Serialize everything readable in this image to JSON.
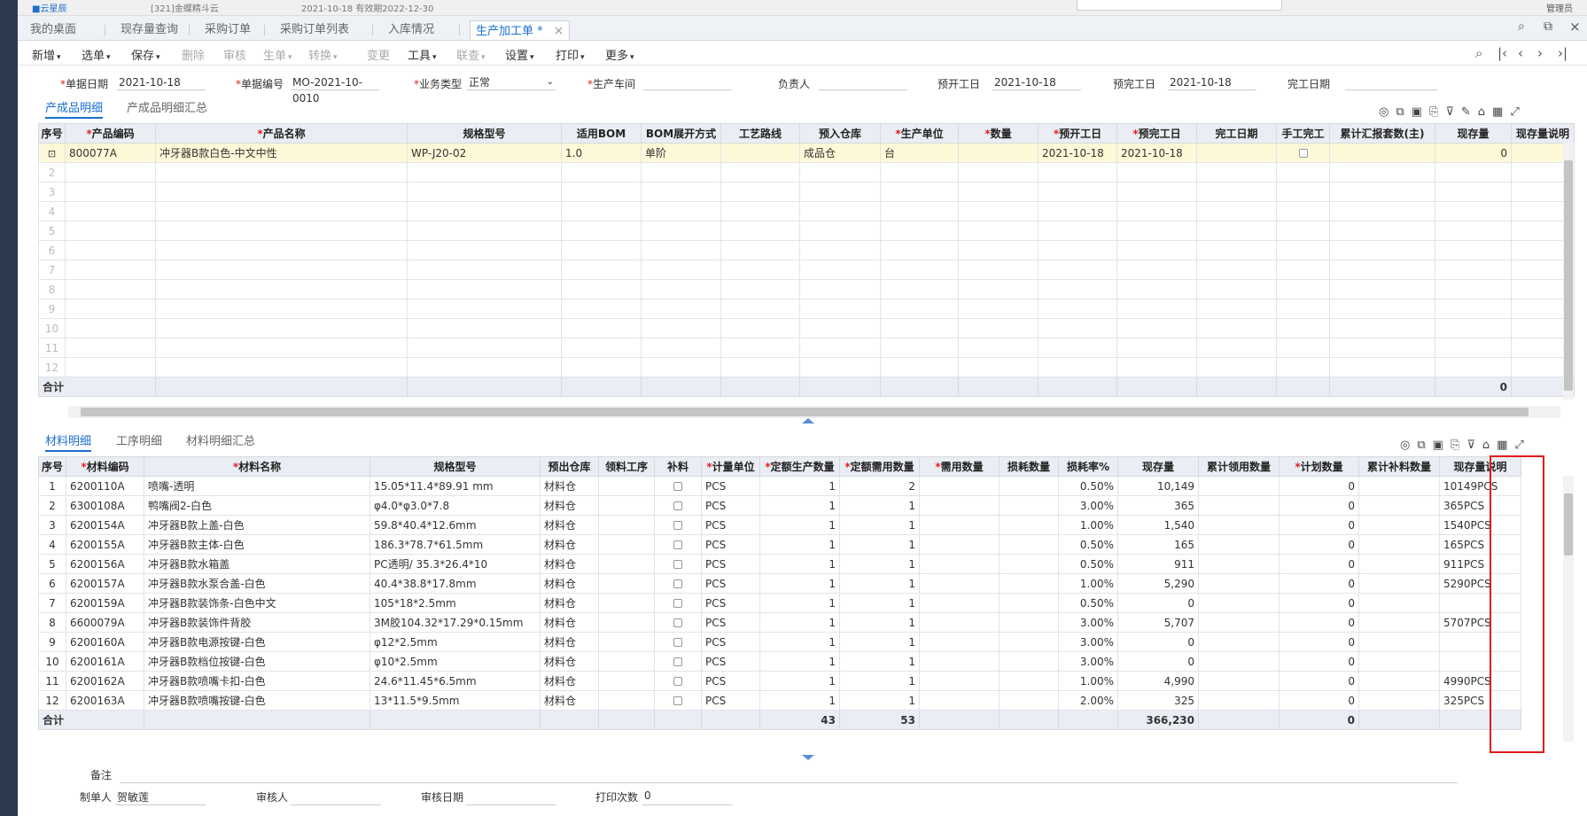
{
  "top": {
    "text1": "■云星辰",
    "text2": "[321]金蝶精斗云",
    "text3": "2021-10-18 有效期2022-12-30",
    "user": "管理员"
  },
  "tabs": [
    {
      "label": "我的桌面"
    },
    {
      "label": "现存量查询"
    },
    {
      "label": "采购订单"
    },
    {
      "label": "采购订单列表"
    },
    {
      "label": "入库情况"
    },
    {
      "label": "生产加工单 *"
    }
  ],
  "close_glyph": "×",
  "toolbar": [
    {
      "label": "新增",
      "dd": true,
      "disabled": false
    },
    {
      "label": "选单",
      "dd": true,
      "disabled": false
    },
    {
      "label": "保存",
      "dd": true,
      "disabled": false
    },
    {
      "label": "删除",
      "dd": false,
      "disabled": true
    },
    {
      "label": "审核",
      "dd": false,
      "disabled": true
    },
    {
      "label": "生单",
      "dd": true,
      "disabled": true
    },
    {
      "label": "转换",
      "dd": true,
      "disabled": true
    },
    {
      "label": "变更",
      "dd": false,
      "disabled": true
    },
    {
      "label": "工具",
      "dd": true,
      "disabled": false
    },
    {
      "label": "联查",
      "dd": true,
      "disabled": true
    },
    {
      "label": "设置",
      "dd": true,
      "disabled": false
    },
    {
      "label": "打印",
      "dd": true,
      "disabled": false
    },
    {
      "label": "更多",
      "dd": true,
      "disabled": false
    }
  ],
  "nav_icons": [
    "search-nav-icon",
    "first-page-icon",
    "prev-page-icon",
    "next-page-icon",
    "last-page-icon"
  ],
  "header_fields": [
    {
      "label": "单据日期",
      "value": "2021-10-18",
      "required": true
    },
    {
      "label": "单据编号",
      "value": "MO-2021-10-0010",
      "required": true
    },
    {
      "label": "业务类型",
      "value": "正常",
      "required": true
    },
    {
      "label": "生产车间",
      "value": "",
      "required": true
    },
    {
      "label": "负责人",
      "value": "",
      "required": false
    },
    {
      "label": "预开工日",
      "value": "2021-10-18",
      "required": false
    },
    {
      "label": "预完工日",
      "value": "2021-10-18",
      "required": false
    },
    {
      "label": "完工日期",
      "value": "",
      "required": false
    }
  ],
  "product_tabs": [
    "产成品明细",
    "产成品明细汇总"
  ],
  "product_grid": {
    "columns": [
      {
        "label": "序号",
        "required": false
      },
      {
        "label": "产品编码",
        "required": true
      },
      {
        "label": "产品名称",
        "required": true
      },
      {
        "label": "规格型号",
        "required": false
      },
      {
        "label": "适用BOM",
        "required": false
      },
      {
        "label": "BOM展开方式",
        "required": false
      },
      {
        "label": "工艺路线",
        "required": false
      },
      {
        "label": "预入仓库",
        "required": false
      },
      {
        "label": "生产单位",
        "required": true
      },
      {
        "label": "数量",
        "required": true
      },
      {
        "label": "预开工日",
        "required": true
      },
      {
        "label": "预完工日",
        "required": true
      },
      {
        "label": "完工日期",
        "required": false
      },
      {
        "label": "手工完工",
        "required": false
      },
      {
        "label": "累计汇报套数(主)",
        "required": false
      },
      {
        "label": "现存量",
        "required": false
      },
      {
        "label": "现存量说明",
        "required": false
      }
    ],
    "rows": [
      {
        "code": "800077A",
        "name": "冲牙器B款白色-中文中性",
        "spec": "WP-J20-02",
        "bom": "1.0",
        "bom_mode": "单阶",
        "route": "",
        "wh": "成品仓",
        "unit": "台",
        "qty": "",
        "start": "2021-10-18",
        "end": "2021-10-18",
        "done": "",
        "manual": "",
        "reported": "",
        "stock": "0",
        "stock_desc": ""
      }
    ],
    "empty_row_numbers": [
      "2",
      "3",
      "4",
      "5",
      "6",
      "7",
      "8",
      "9",
      "10",
      "11",
      "12"
    ],
    "sum_label": "合计",
    "sum_stock": "0"
  },
  "material_tabs": [
    "材料明细",
    "工序明细",
    "材料明细汇总"
  ],
  "material_grid": {
    "columns": [
      {
        "label": "序号",
        "required": false
      },
      {
        "label": "材料编码",
        "required": true
      },
      {
        "label": "材料名称",
        "required": true
      },
      {
        "label": "规格型号",
        "required": false
      },
      {
        "label": "预出仓库",
        "required": false
      },
      {
        "label": "领料工序",
        "required": false
      },
      {
        "label": "补料",
        "required": false
      },
      {
        "label": "计量单位",
        "required": true
      },
      {
        "label": "定额生产数量",
        "required": true
      },
      {
        "label": "定额需用数量",
        "required": true
      },
      {
        "label": "需用数量",
        "required": true
      },
      {
        "label": "损耗数量",
        "required": false
      },
      {
        "label": "损耗率%",
        "required": false
      },
      {
        "label": "现存量",
        "required": false
      },
      {
        "label": "累计领用数量",
        "required": false
      },
      {
        "label": "计划数量",
        "required": true
      },
      {
        "label": "累计补料数量",
        "required": false
      },
      {
        "label": "现存量说明",
        "required": false
      }
    ],
    "rows": [
      {
        "no": "1",
        "code": "6200110A",
        "name": "喷嘴-透明",
        "spec": "15.05*11.4*89.91 mm",
        "wh": "材料仓",
        "unit": "PCS",
        "prod_qty": "1",
        "need_qty": "2",
        "loss_rate": "0.50%",
        "stock": "10,149",
        "plan": "0",
        "stock_desc": "10149PCS"
      },
      {
        "no": "2",
        "code": "6300108A",
        "name": "鸭嘴阀2-白色",
        "spec": "φ4.0*φ3.0*7.8",
        "wh": "材料仓",
        "unit": "PCS",
        "prod_qty": "1",
        "need_qty": "1",
        "loss_rate": "3.00%",
        "stock": "365",
        "plan": "0",
        "stock_desc": "365PCS"
      },
      {
        "no": "3",
        "code": "6200154A",
        "name": "冲牙器B款上盖-白色",
        "spec": "59.8*40.4*12.6mm",
        "wh": "材料仓",
        "unit": "PCS",
        "prod_qty": "1",
        "need_qty": "1",
        "loss_rate": "1.00%",
        "stock": "1,540",
        "plan": "0",
        "stock_desc": "1540PCS"
      },
      {
        "no": "4",
        "code": "6200155A",
        "name": "冲牙器B款主体-白色",
        "spec": "186.3*78.7*61.5mm",
        "wh": "材料仓",
        "unit": "PCS",
        "prod_qty": "1",
        "need_qty": "1",
        "loss_rate": "0.50%",
        "stock": "165",
        "plan": "0",
        "stock_desc": "165PCS"
      },
      {
        "no": "5",
        "code": "6200156A",
        "name": "冲牙器B款水箱盖",
        "spec": "PC透明/ 35.3*26.4*10",
        "wh": "材料仓",
        "unit": "PCS",
        "prod_qty": "1",
        "need_qty": "1",
        "loss_rate": "0.50%",
        "stock": "911",
        "plan": "0",
        "stock_desc": "911PCS"
      },
      {
        "no": "6",
        "code": "6200157A",
        "name": "冲牙器B款水泵合盖-白色",
        "spec": "40.4*38.8*17.8mm",
        "wh": "材料仓",
        "unit": "PCS",
        "prod_qty": "1",
        "need_qty": "1",
        "loss_rate": "1.00%",
        "stock": "5,290",
        "plan": "0",
        "stock_desc": "5290PCS"
      },
      {
        "no": "7",
        "code": "6200159A",
        "name": "冲牙器B款装饰条-白色中文",
        "spec": "105*18*2.5mm",
        "wh": "材料仓",
        "unit": "PCS",
        "prod_qty": "1",
        "need_qty": "1",
        "loss_rate": "0.50%",
        "stock": "0",
        "plan": "0",
        "stock_desc": ""
      },
      {
        "no": "8",
        "code": "6600079A",
        "name": "冲牙器B款装饰件背胶",
        "spec": "3M胶104.32*17.29*0.15mm",
        "wh": "材料仓",
        "unit": "PCS",
        "prod_qty": "1",
        "need_qty": "1",
        "loss_rate": "3.00%",
        "stock": "5,707",
        "plan": "0",
        "stock_desc": "5707PCS"
      },
      {
        "no": "9",
        "code": "6200160A",
        "name": "冲牙器B款电源按键-白色",
        "spec": "φ12*2.5mm",
        "wh": "材料仓",
        "unit": "PCS",
        "prod_qty": "1",
        "need_qty": "1",
        "loss_rate": "3.00%",
        "stock": "0",
        "plan": "0",
        "stock_desc": ""
      },
      {
        "no": "10",
        "code": "6200161A",
        "name": "冲牙器B款档位按键-白色",
        "spec": "φ10*2.5mm",
        "wh": "材料仓",
        "unit": "PCS",
        "prod_qty": "1",
        "need_qty": "1",
        "loss_rate": "3.00%",
        "stock": "0",
        "plan": "0",
        "stock_desc": ""
      },
      {
        "no": "11",
        "code": "6200162A",
        "name": "冲牙器B款喷嘴卡扣-白色",
        "spec": "24.6*11.45*6.5mm",
        "wh": "材料仓",
        "unit": "PCS",
        "prod_qty": "1",
        "need_qty": "1",
        "loss_rate": "1.00%",
        "stock": "4,990",
        "plan": "0",
        "stock_desc": "4990PCS"
      },
      {
        "no": "12",
        "code": "6200163A",
        "name": "冲牙器B款喷嘴按键-白色",
        "spec": "13*11.5*9.5mm",
        "wh": "材料仓",
        "unit": "PCS",
        "prod_qty": "1",
        "need_qty": "1",
        "loss_rate": "2.00%",
        "stock": "325",
        "plan": "0",
        "stock_desc": "325PCS"
      }
    ],
    "sum_label": "合计",
    "sum_prod_qty": "43",
    "sum_need_qty": "53",
    "sum_stock": "366,230",
    "sum_plan": "0"
  },
  "footer": {
    "remark_label": "备注",
    "maker_label": "制单人",
    "maker_value": "贺敏莲",
    "auditor_label": "审核人",
    "auditor_value": "",
    "audit_date_label": "审核日期",
    "audit_date_value": "",
    "print_count_label": "打印次数",
    "print_count_value": "0"
  },
  "colors": {
    "accent": "#1a6fd0",
    "required": "#e02020",
    "highlight_box": "#e31919",
    "selected_row": "#fdf8d7"
  }
}
